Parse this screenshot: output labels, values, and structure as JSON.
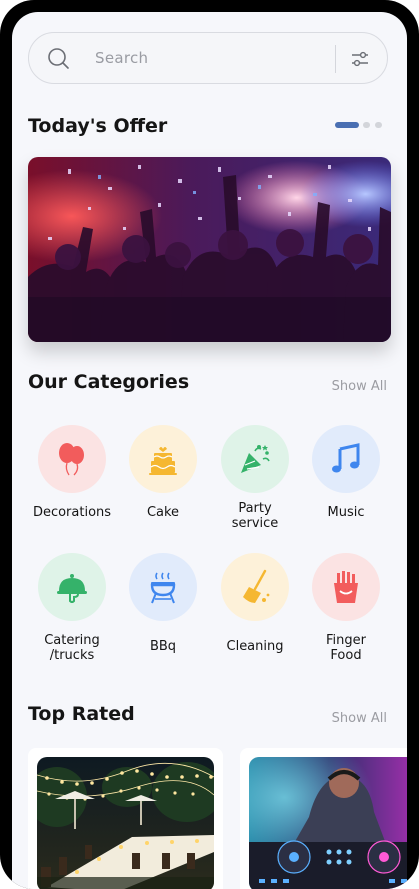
{
  "search": {
    "placeholder": "Search",
    "icon": "search-icon",
    "filter_icon": "filter-sliders-icon"
  },
  "offer": {
    "title": "Today's Offer",
    "carousel_pages": 3,
    "active_page": 1,
    "image": "party-crowd-confetti"
  },
  "categories": {
    "title": "Our Categories",
    "show_all": "Show All",
    "items": [
      {
        "label": "Decorations",
        "icon": "balloons-icon",
        "bg": "#fbe3e3",
        "color": "#f25c5c"
      },
      {
        "label": "Cake",
        "icon": "cake-icon",
        "bg": "#fdf1d9",
        "color": "#f5b731"
      },
      {
        "label": "Party\nservice",
        "icon": "party-popper-icon",
        "bg": "#dff3e8",
        "color": "#35b26a"
      },
      {
        "label": "Music",
        "icon": "music-note-icon",
        "bg": "#e1ebfb",
        "color": "#3f86ee"
      },
      {
        "label": "Catering\n/trucks",
        "icon": "cloche-icon",
        "bg": "#dff3e8",
        "color": "#35b26a"
      },
      {
        "label": "BBq",
        "icon": "grill-icon",
        "bg": "#e1ebfb",
        "color": "#3f86ee"
      },
      {
        "label": "Cleaning",
        "icon": "broom-icon",
        "bg": "#fdf1d9",
        "color": "#f5b731"
      },
      {
        "label": "Finger\nFood",
        "icon": "fries-icon",
        "bg": "#fbe3e3",
        "color": "#f25c5c"
      }
    ]
  },
  "top_rated": {
    "title": "Top Rated",
    "show_all": "Show All",
    "cards": [
      {
        "image": "outdoor-dinner-string-lights"
      },
      {
        "image": "dj-turntables"
      }
    ]
  },
  "colors": {
    "accent": "#4a6fb2",
    "background": "#f6f7fb"
  }
}
